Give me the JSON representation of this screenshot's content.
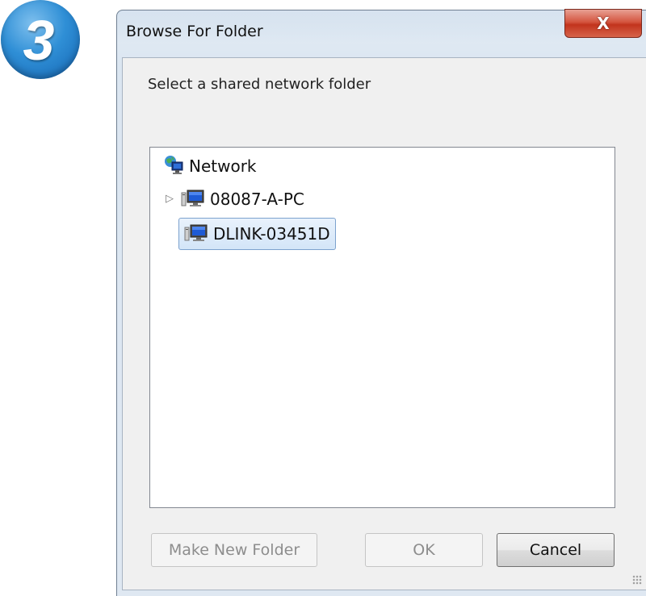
{
  "step": {
    "number": "3"
  },
  "window": {
    "title": "Browse For Folder",
    "close_label": "X"
  },
  "dialog": {
    "prompt": "Select a shared network folder"
  },
  "tree": {
    "items": [
      {
        "label": "Network",
        "icon": "network-globe-icon",
        "expandable": false,
        "selected": false
      },
      {
        "label": "08087-A-PC",
        "icon": "computer-icon",
        "expandable": true,
        "selected": false
      },
      {
        "label": "DLINK-03451D",
        "icon": "computer-icon",
        "expandable": false,
        "selected": true
      }
    ]
  },
  "buttons": {
    "make_new_folder": "Make New Folder",
    "ok": "OK",
    "cancel": "Cancel"
  },
  "colors": {
    "selection": "#d3e5f8",
    "close_button": "#c2341d",
    "badge": "#2f8fd6"
  }
}
